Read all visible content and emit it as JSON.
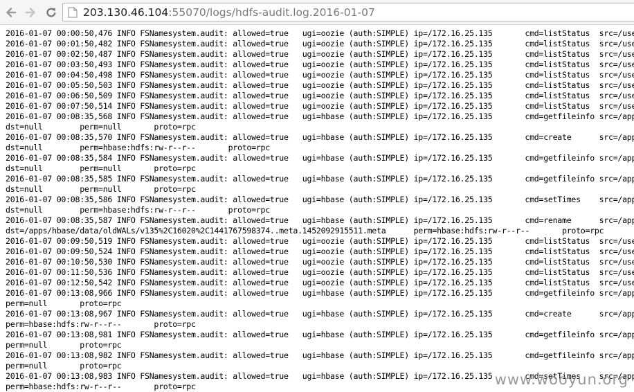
{
  "browser": {
    "url_host": "203.130.46.104",
    "url_rest": ":55070/logs/hdfs-audit.log.2016-01-07",
    "icons": {
      "back": "back-arrow-icon",
      "forward": "forward-arrow-icon",
      "reload": "reload-icon",
      "page": "page-icon"
    }
  },
  "log": {
    "lines": [
      "2016-01-07 00:00:50,476 INFO FSNamesystem.audit: allowed=true   ugi=oozie (auth:SIMPLE) ip=/172.16.25.135       cmd=listStatus  src=/user/oozie",
      "2016-01-07 00:01:50,482 INFO FSNamesystem.audit: allowed=true   ugi=oozie (auth:SIMPLE) ip=/172.16.25.135       cmd=listStatus  src=/user/oozie",
      "2016-01-07 00:02:50,487 INFO FSNamesystem.audit: allowed=true   ugi=oozie (auth:SIMPLE) ip=/172.16.25.135       cmd=listStatus  src=/user/oozie",
      "2016-01-07 00:03:50,493 INFO FSNamesystem.audit: allowed=true   ugi=oozie (auth:SIMPLE) ip=/172.16.25.135       cmd=listStatus  src=/user/oozie",
      "2016-01-07 00:04:50,498 INFO FSNamesystem.audit: allowed=true   ugi=oozie (auth:SIMPLE) ip=/172.16.25.135       cmd=listStatus  src=/user/oozie",
      "2016-01-07 00:05:50,503 INFO FSNamesystem.audit: allowed=true   ugi=oozie (auth:SIMPLE) ip=/172.16.25.135       cmd=listStatus  src=/user/oozie",
      "2016-01-07 00:06:50,509 INFO FSNamesystem.audit: allowed=true   ugi=oozie (auth:SIMPLE) ip=/172.16.25.135       cmd=listStatus  src=/user/oozie",
      "2016-01-07 00:07:50,514 INFO FSNamesystem.audit: allowed=true   ugi=oozie (auth:SIMPLE) ip=/172.16.25.135       cmd=listStatus  src=/user/oozie",
      "2016-01-07 00:08:35,568 INFO FSNamesystem.audit: allowed=true   ugi=hbase (auth:SIMPLE) ip=/172.16.25.135       cmd=getfileinfo src=/apps/hbase",
      "dst=null        perm=null       proto=rpc",
      "2016-01-07 00:08:35,570 INFO FSNamesystem.audit: allowed=true   ugi=hbase (auth:SIMPLE) ip=/172.16.25.135       cmd=create      src=/apps/hbase",
      "dst=null        perm=hbase:hdfs:rw-r--r--       proto=rpc",
      "2016-01-07 00:08:35,584 INFO FSNamesystem.audit: allowed=true   ugi=hbase (auth:SIMPLE) ip=/172.16.25.135       cmd=getfileinfo src=/apps/hbase",
      "dst=null        perm=null       proto=rpc",
      "2016-01-07 00:08:35,585 INFO FSNamesystem.audit: allowed=true   ugi=hbase (auth:SIMPLE) ip=/172.16.25.135       cmd=getfileinfo src=/apps/hbase",
      "dst=null        perm=null       proto=rpc",
      "2016-01-07 00:08:35,586 INFO FSNamesystem.audit: allowed=true   ugi=hbase (auth:SIMPLE) ip=/172.16.25.135       cmd=setTimes    src=/apps/hbase",
      "dst=null        perm=hbase:hdfs:rw-r--r--       proto=rpc",
      "2016-01-07 00:08:35,587 INFO FSNamesystem.audit: allowed=true   ugi=hbase (auth:SIMPLE) ip=/172.16.25.135       cmd=rename      src=/apps/hbase",
      "dst=/apps/hbase/data/oldWALs/v135%2C16020%2C1441767598374..meta.1452092915511.meta      perm=hbase:hdfs:rw-r--r--       proto=rpc",
      "2016-01-07 00:09:50,519 INFO FSNamesystem.audit: allowed=true   ugi=oozie (auth:SIMPLE) ip=/172.16.25.135       cmd=listStatus  src=/user/oozie",
      "2016-01-07 00:09:50,524 INFO FSNamesystem.audit: allowed=true   ugi=oozie (auth:SIMPLE) ip=/172.16.25.135       cmd=listStatus  src=/user/oozie",
      "2016-01-07 00:10:50,530 INFO FSNamesystem.audit: allowed=true   ugi=oozie (auth:SIMPLE) ip=/172.16.25.135       cmd=listStatus  src=/user/oozie",
      "2016-01-07 00:11:50,536 INFO FSNamesystem.audit: allowed=true   ugi=oozie (auth:SIMPLE) ip=/172.16.25.135       cmd=listStatus  src=/user/oozie",
      "2016-01-07 00:12:50,542 INFO FSNamesystem.audit: allowed=true   ugi=oozie (auth:SIMPLE) ip=/172.16.25.135       cmd=listStatus  src=/user/oozie",
      "2016-01-07 00:13:08,966 INFO FSNamesystem.audit: allowed=true   ugi=hbase (auth:SIMPLE) ip=/172.16.25.135       cmd=getfileinfo src=/apps/hbase",
      "perm=null       proto=rpc",
      "2016-01-07 00:13:08,967 INFO FSNamesystem.audit: allowed=true   ugi=hbase (auth:SIMPLE) ip=/172.16.25.135       cmd=create      src=/apps/hbase",
      "perm=hbase:hdfs:rw-r--r--       proto=rpc",
      "2016-01-07 00:13:08,981 INFO FSNamesystem.audit: allowed=true   ugi=hbase (auth:SIMPLE) ip=/172.16.25.135       cmd=getfileinfo src=/apps/hbase",
      "perm=null       proto=rpc",
      "2016-01-07 00:13:08,982 INFO FSNamesystem.audit: allowed=true   ugi=hbase (auth:SIMPLE) ip=/172.16.25.135       cmd=getfileinfo src=/apps/hbase",
      "perm=null       proto=rpc",
      "2016-01-07 00:13:08,983 INFO FSNamesystem.audit: allowed=true   ugi=hbase (auth:SIMPLE) ip=/172.16.25.135       cmd=setTimes    src=/apps/hbase",
      "perm=hbase:hdfs:rw-r--r--       proto=rpc"
    ]
  },
  "watermark": "www.wooyun.org"
}
